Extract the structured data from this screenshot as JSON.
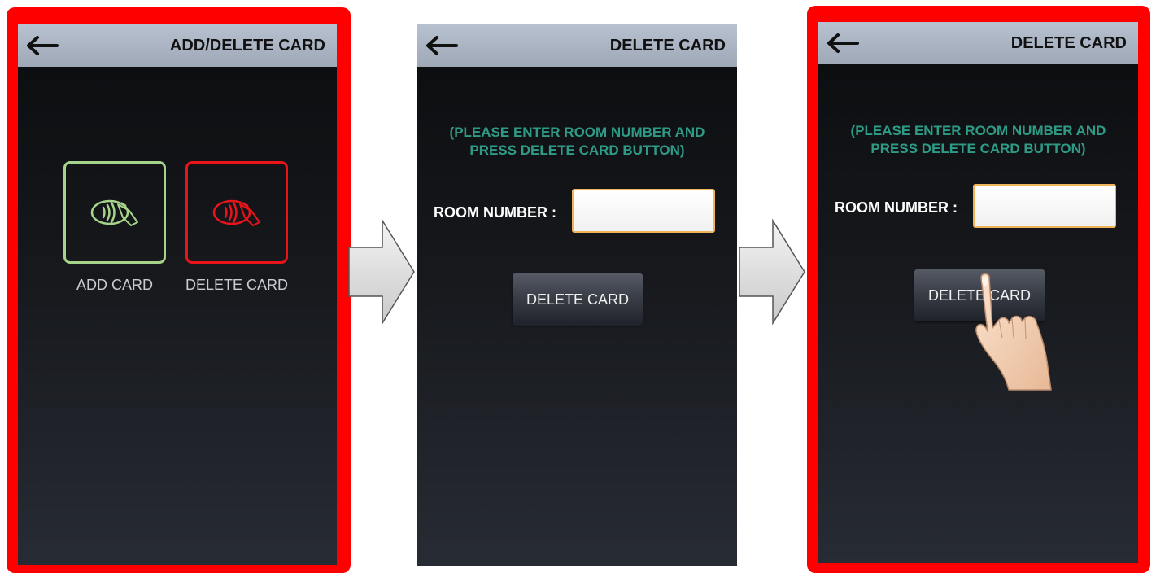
{
  "screens": [
    {
      "title": "ADD/DELETE CARD",
      "tiles": [
        {
          "label": "ADD CARD",
          "icon": "contactless-card-icon",
          "color": "#a6d38a"
        },
        {
          "label": "DELETE CARD",
          "icon": "contactless-card-icon",
          "color": "#e8141a"
        }
      ],
      "highlighted": true
    },
    {
      "title": "DELETE CARD",
      "instruction_line1": "(PLEASE ENTER ROOM NUMBER AND",
      "instruction_line2": "PRESS DELETE CARD BUTTON)",
      "room_label": "ROOM NUMBER :",
      "room_value": "",
      "button_label": "DELETE CARD",
      "highlighted": false
    },
    {
      "title": "DELETE CARD",
      "instruction_line1": "(PLEASE ENTER ROOM NUMBER AND",
      "instruction_line2": "PRESS DELETE CARD BUTTON)",
      "room_label": "ROOM NUMBER :",
      "room_value": "",
      "button_label": "DELETE CARD",
      "highlighted": true,
      "pointer": "tapping-hand-icon"
    }
  ],
  "colors": {
    "highlight_frame": "#ff0000",
    "instruction_text": "#2e9b86",
    "add_tile": "#a6d38a",
    "delete_tile": "#e8141a",
    "input_border": "#f0b45a"
  }
}
